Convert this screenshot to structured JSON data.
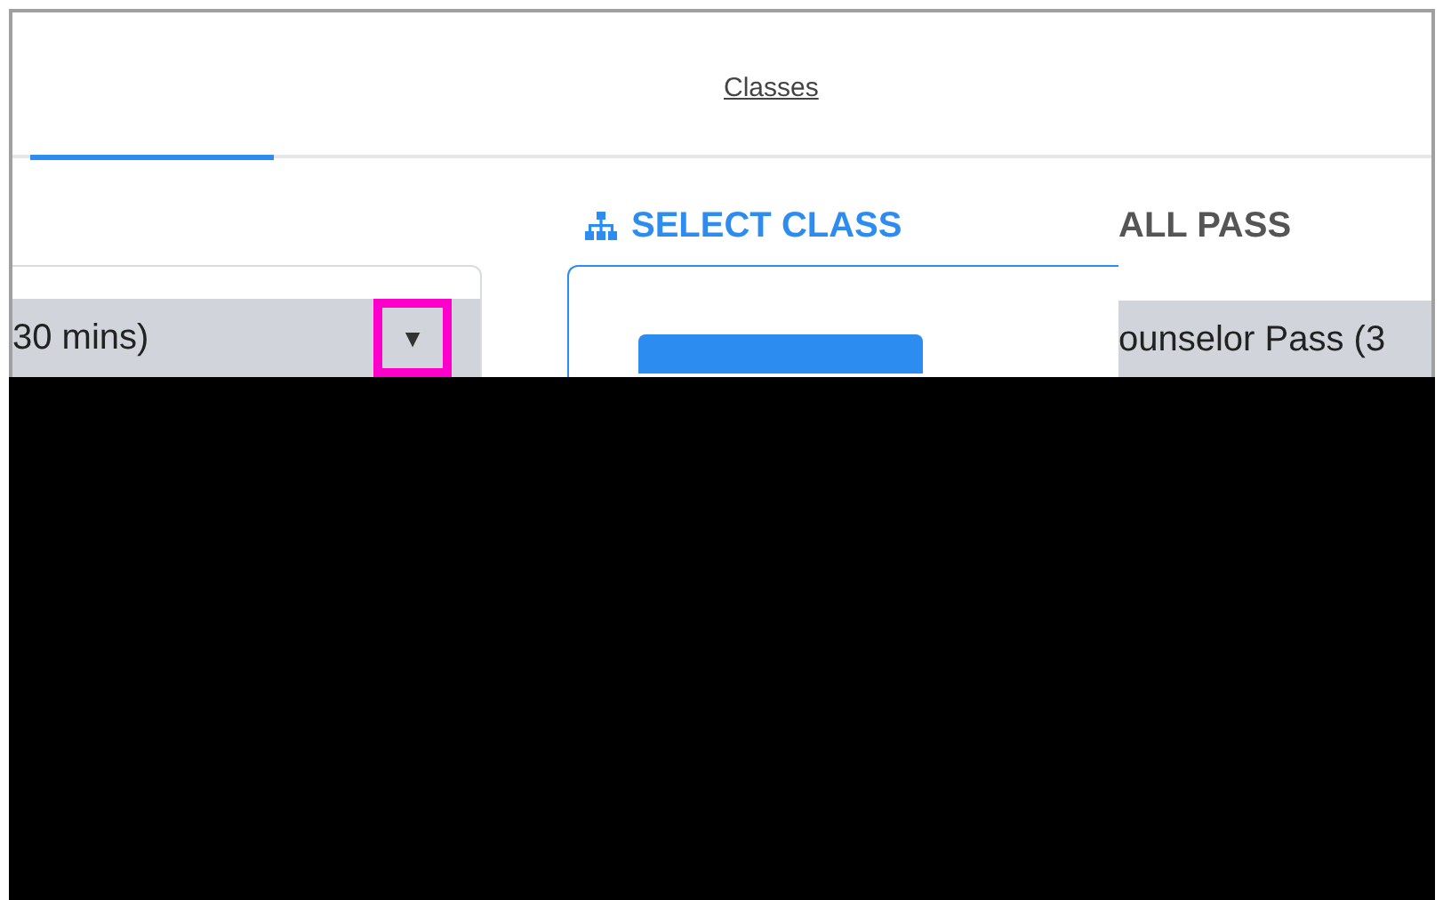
{
  "tabs": [
    {
      "label": "Classes",
      "selected": false
    }
  ],
  "left_panel": {
    "dropdown": {
      "value": "30 mins)",
      "arrow": "▼",
      "highlighted": true
    }
  },
  "select_class": {
    "title": "SELECT CLASS"
  },
  "right_panel": {
    "title": "ALL PASS",
    "dropdown": {
      "value": "ounselor Pass (3"
    }
  }
}
